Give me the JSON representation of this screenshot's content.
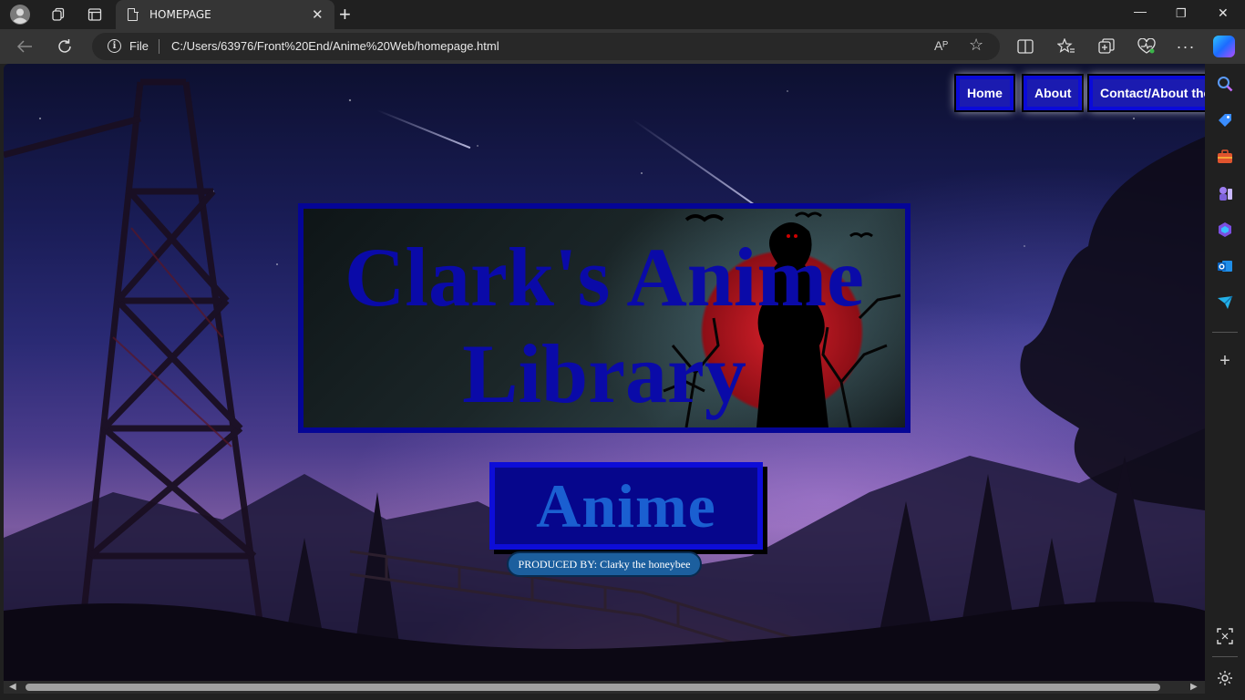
{
  "browser": {
    "tab_title": "HOMEPAGE",
    "tab_close": "✕",
    "new_tab": "+",
    "window_controls": {
      "minimize": "—",
      "maximize": "❐",
      "close": "✕"
    },
    "address": {
      "scheme_label": "File",
      "url": "C:/Users/63976/Front%20End/Anime%20Web/homepage.html",
      "read_aloud": "Aᴾ",
      "favorite": "☆"
    },
    "toolbar_icons": [
      "split-screen-icon",
      "favorites-icon",
      "collections-icon",
      "browser-essentials-icon",
      "more-icon"
    ],
    "sidebar_icons": [
      "search-icon",
      "shopping-icon",
      "tools-icon",
      "games-icon",
      "office-icon",
      "outlook-icon",
      "send-icon",
      "add-icon",
      "screenshot-icon",
      "settings-icon"
    ]
  },
  "page": {
    "nav": {
      "home": "Home",
      "about": "About",
      "contact": "Contact/About the d"
    },
    "title": "Clark's Anime Library",
    "anime_button": "Anime",
    "credit": "PRODUCED BY: Clarky the honeybee"
  },
  "colors": {
    "nav_fill": "#1b1bb0",
    "nav_border": "#0a0ad8",
    "title_text": "#0a0aa8",
    "anime_text": "#1a5fd1",
    "credit_fill": "#1c5f9e"
  }
}
